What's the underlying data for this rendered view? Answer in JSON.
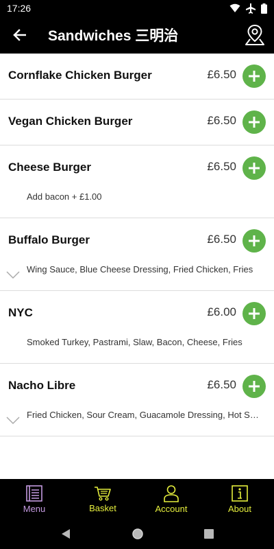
{
  "status_bar": {
    "time": "17:26"
  },
  "header": {
    "title": "Sandwiches 三明治"
  },
  "items": [
    {
      "name": "Cornflake Chicken Burger",
      "price": "£6.50",
      "description": "",
      "expandable": false
    },
    {
      "name": "Vegan Chicken Burger",
      "price": "£6.50",
      "description": "",
      "expandable": false
    },
    {
      "name": "Cheese Burger",
      "price": "£6.50",
      "description": "Add bacon + £1.00",
      "expandable": false
    },
    {
      "name": "Buffalo Burger",
      "price": "£6.50",
      "description": "Wing Sauce, Blue Cheese Dressing, Fried Chicken, Fries",
      "expandable": true
    },
    {
      "name": "NYC",
      "price": "£6.00",
      "description": "Smoked Turkey, Pastrami, Slaw, Bacon, Cheese, Fries",
      "expandable": false
    },
    {
      "name": "Nacho Libre",
      "price": "£6.50",
      "description": "Fried Chicken, Sour Cream, Guacamole Dressing, Hot Sauce",
      "expandable": true
    }
  ],
  "bottom_nav": [
    {
      "label": "Menu",
      "icon": "menu-book-icon",
      "active": true
    },
    {
      "label": "Basket",
      "icon": "basket-icon",
      "active": false
    },
    {
      "label": "Account",
      "icon": "account-icon",
      "active": false
    },
    {
      "label": "About",
      "icon": "info-icon",
      "active": false
    }
  ],
  "colors": {
    "add_button": "#5fb34a",
    "nav_active": "#c49ae0",
    "nav_inactive": "#e6ef3d",
    "bar_background": "#000000"
  }
}
